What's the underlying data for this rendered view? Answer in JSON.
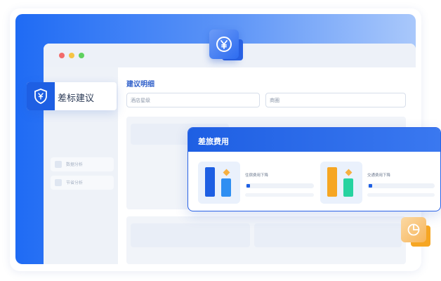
{
  "colors": {
    "brand_blue": "#1e5fe3",
    "accent_orange": "#f6a623",
    "accent_green": "#27d3a0",
    "dot_red": "#f26b6b",
    "dot_yellow": "#f6c445",
    "dot_green": "#5fd15f"
  },
  "icons": {
    "yen_badge": "yen-coin-icon",
    "shield": "yen-shield-icon",
    "pie": "pie-chart-icon"
  },
  "ribbon": {
    "label": "差标建议"
  },
  "sidebar": {
    "items": [
      {
        "label": "数据分析"
      },
      {
        "label": "节省分析"
      }
    ]
  },
  "main": {
    "title": "建议明细",
    "fields": {
      "hotel_level": "酒店星级",
      "route": "商圈"
    }
  },
  "card": {
    "title": "差旅费用",
    "stats": [
      {
        "label": "住宿费用下降",
        "progress": 0.05
      },
      {
        "label": "交通费用下降",
        "progress": 0.05
      }
    ]
  }
}
